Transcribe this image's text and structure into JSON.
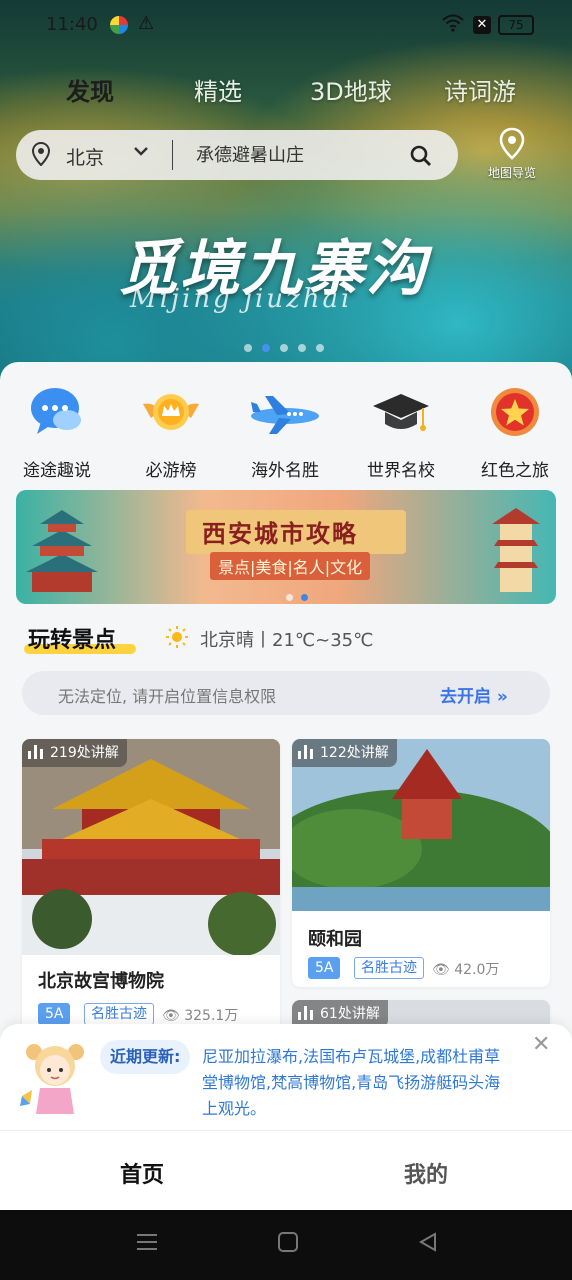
{
  "status": {
    "time": "11:40",
    "battery": "75",
    "x_badge": "✕"
  },
  "tabs": [
    "发现",
    "精选",
    "3D地球",
    "诗词游"
  ],
  "search": {
    "city": "北京",
    "placeholder": "承德避暑山庄"
  },
  "map_guide_label": "地图导览",
  "hero": {
    "title": "觅境九寨沟",
    "subtitle": "Mijing jiuzhai"
  },
  "quick_links": [
    {
      "label": "途途趣说",
      "icon": "chat-bubble-icon"
    },
    {
      "label": "必游榜",
      "icon": "crown-medal-icon"
    },
    {
      "label": "海外名胜",
      "icon": "airplane-icon"
    },
    {
      "label": "世界名校",
      "icon": "graduation-cap-icon"
    },
    {
      "label": "红色之旅",
      "icon": "red-star-badge-icon"
    }
  ],
  "promo": {
    "title": "西安城市攻略",
    "subtitle": "景点|美食|名人|文化"
  },
  "section": {
    "title": "玩转景点",
    "weather": "北京晴丨21℃~35℃"
  },
  "location_bar": {
    "message": "无法定位, 请开启位置信息权限",
    "action": "去开启"
  },
  "cards": [
    {
      "badge": "219处讲解",
      "name": "北京故宫博物院",
      "level": "5A",
      "category": "名胜古迹",
      "views": "325.1万"
    },
    {
      "badge": "122处讲解",
      "name": "颐和园",
      "level": "5A",
      "category": "名胜古迹",
      "views": "42.0万"
    },
    {
      "badge": "61处讲解"
    }
  ],
  "notice": {
    "label": "近期更新:",
    "text": "尼亚加拉瀑布,法国布卢瓦城堡,成都杜甫草堂博物馆,梵高博物馆,青岛飞扬游艇码头海上观光。"
  },
  "bottom_nav": {
    "home": "首页",
    "mine": "我的"
  },
  "colors": {
    "accent_blue": "#3b74e6",
    "highlight_yellow": "#ffd33d"
  }
}
